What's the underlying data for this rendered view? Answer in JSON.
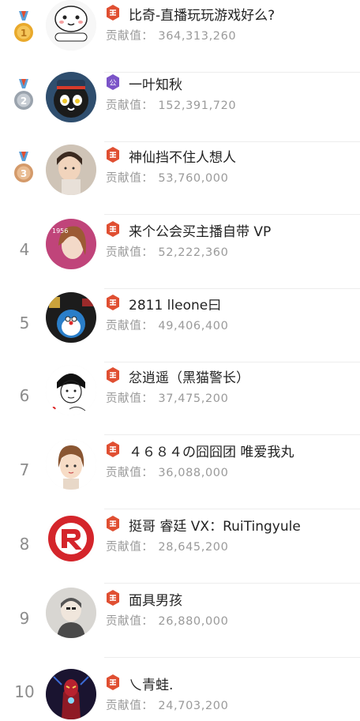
{
  "contribution_label": "贡献值：",
  "colors": {
    "gold": "#e9a92b",
    "silver": "#9aa3ad",
    "bronze": "#d49a6a",
    "king_badge": "#e04f32",
    "guild_badge": "#7b54c8"
  },
  "items": [
    {
      "rank": "1",
      "name": "比奇-直播玩玩游戏好么?",
      "value": "364,313,260",
      "badge": "king"
    },
    {
      "rank": "2",
      "name": "一叶知秋",
      "value": "152,391,720",
      "badge": "guild"
    },
    {
      "rank": "3",
      "name": "神仙挡不住人想人",
      "value": "53,760,000",
      "badge": "king"
    },
    {
      "rank": "4",
      "name": "来个公会买主播自带 VP",
      "value": "52,222,360",
      "badge": "king"
    },
    {
      "rank": "5",
      "name": "2811 lleone曰",
      "value": "49,406,400",
      "badge": "king"
    },
    {
      "rank": "6",
      "name": "忿逍遥（黑猫警长）",
      "value": "37,475,200",
      "badge": "king"
    },
    {
      "rank": "7",
      "name": "４６８４の囧囧团 唯爱我丸",
      "value": "36,088,000",
      "badge": "king"
    },
    {
      "rank": "8",
      "name": "挺哥 睿廷 VX：RuiTingyule",
      "value": "28,645,200",
      "badge": "king"
    },
    {
      "rank": "9",
      "name": "面具男孩",
      "value": "26,880,000",
      "badge": "king"
    },
    {
      "rank": "10",
      "name": "乀青蛙.",
      "value": "24,703,200",
      "badge": "king"
    }
  ]
}
